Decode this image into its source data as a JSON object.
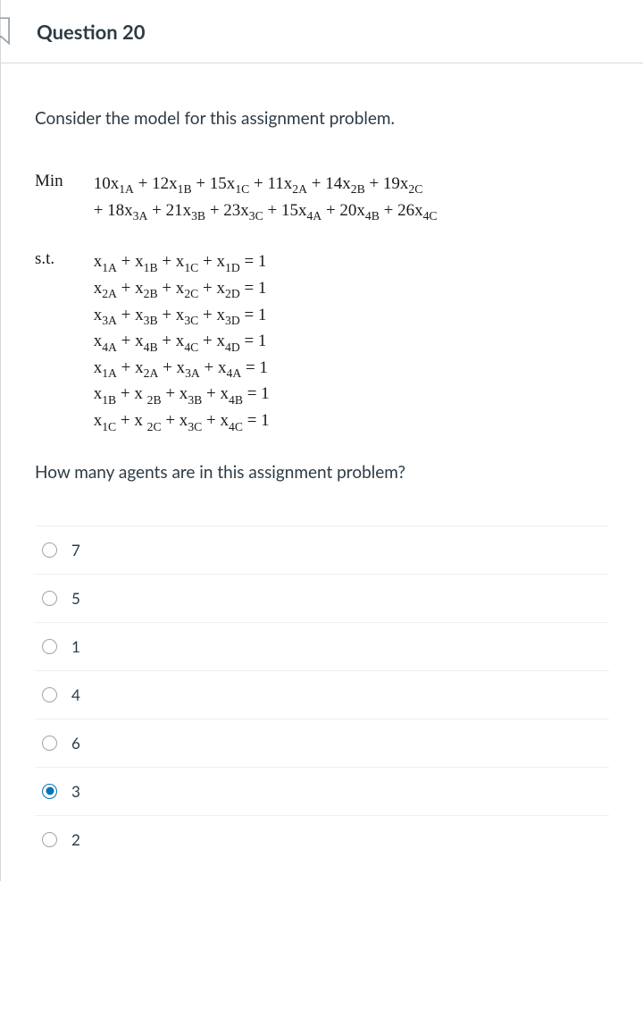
{
  "header": {
    "title": "Question 20"
  },
  "prompt": "Consider the model for this assignment problem.",
  "math": {
    "min_label": "Min",
    "objective_line1_html": "10x<span class='sub'>1A</span> + 12x<span class='sub'>1B</span> + 15x<span class='sub'>1C</span> + 11x<span class='sub'>2A</span> + 14x<span class='sub'>2B</span> + 19x<span class='sub'>2C</span>",
    "objective_line2_html": "+ 18x<span class='sub'>3A</span> + 21x<span class='sub'>3B</span> + 23x<span class='sub'>3C</span> + 15x<span class='sub'>4A</span> + 20x<span class='sub'>4B</span> + 26x<span class='sub'>4C</span>",
    "st_label": "s.t.",
    "constraints_html": [
      "x<span class='sub'>1A</span> + x<span class='sub'>1B</span> + x<span class='sub'>1C</span> + x<span class='sub'>1D</span> = 1",
      "x<span class='sub'>2A</span> + x<span class='sub'>2B</span> + x<span class='sub'>2C</span> + x<span class='sub'>2D</span> = 1",
      "x<span class='sub'>3A</span> + x<span class='sub'>3B</span> + x<span class='sub'>3C</span> + x<span class='sub'>3D</span> = 1",
      "x<span class='sub'>4A</span> + x<span class='sub'>4B</span> + x<span class='sub'>4C</span> + x<span class='sub'>4D</span> = 1",
      "x<span class='sub'>1A</span> + x<span class='sub'>2A</span> + x<span class='sub'>3A</span> + x<span class='sub'>4A</span> = 1",
      "x<span class='sub'>1B</span> + x <span class='sub'>2B</span> + x<span class='sub'>3B</span> + x<span class='sub'>4B</span> = 1",
      "x<span class='sub'>1C</span> + x <span class='sub'>2C</span> + x<span class='sub'>3C</span> + x<span class='sub'>4C</span> = 1"
    ]
  },
  "followup": "How many agents are in this assignment problem?",
  "options": [
    {
      "label": "7",
      "checked": false
    },
    {
      "label": "5",
      "checked": false
    },
    {
      "label": "1",
      "checked": false
    },
    {
      "label": "4",
      "checked": false
    },
    {
      "label": "6",
      "checked": false
    },
    {
      "label": "3",
      "checked": true
    },
    {
      "label": "2",
      "checked": false
    }
  ]
}
